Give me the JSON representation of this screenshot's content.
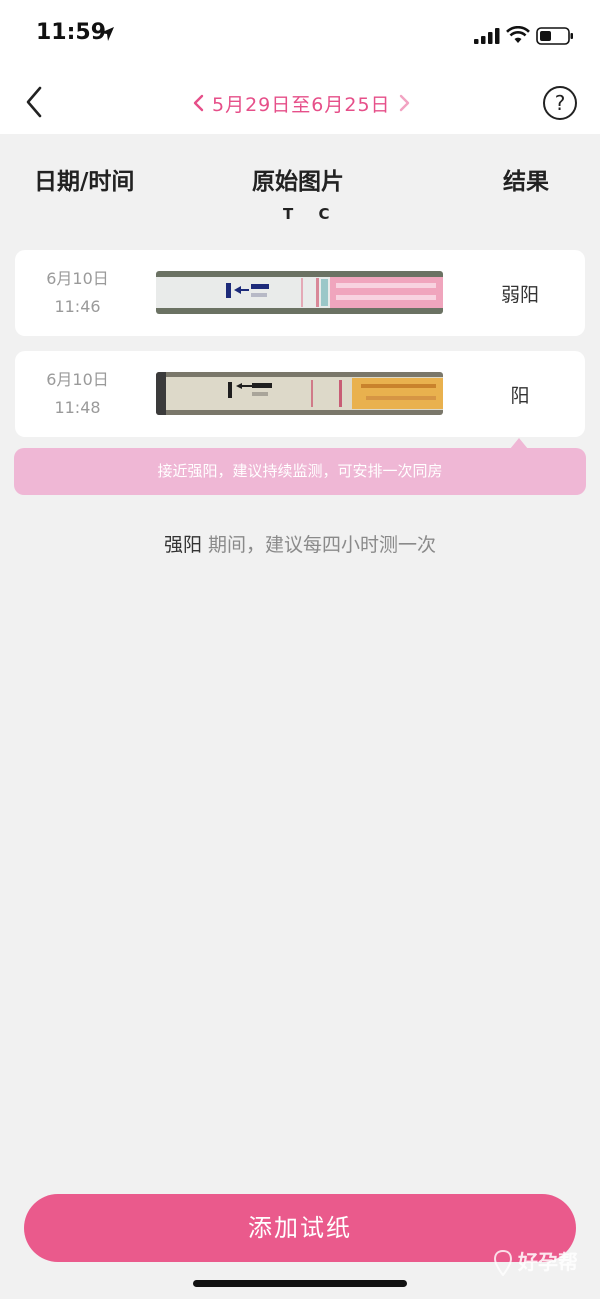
{
  "status": {
    "time": "11:59"
  },
  "nav": {
    "range": "5月29日至6月25日",
    "help": "?"
  },
  "columns": {
    "date": "日期/时间",
    "image": "原始图片",
    "result": "结果",
    "tc": "T C"
  },
  "records": [
    {
      "date": "6月10日",
      "time": "11:46",
      "result": "弱阳"
    },
    {
      "date": "6月10日",
      "time": "11:48",
      "result": "阳"
    }
  ],
  "tip": "接近强阳，建议持续监测，可安排一次同房",
  "advice": {
    "phase": "强阳",
    "text": " 期间，建议每四小时测一次"
  },
  "add_button": "添加试纸",
  "watermark": "好孕帮",
  "colors": {
    "accent": "#e64f89",
    "button": "#ea5a8c",
    "tip_bg": "#efb7d5"
  },
  "icons": [
    "location-arrow-icon",
    "signal-icon",
    "wifi-icon",
    "battery-icon",
    "back-chevron-icon",
    "prev-chevron-icon",
    "next-chevron-icon",
    "help-icon"
  ]
}
